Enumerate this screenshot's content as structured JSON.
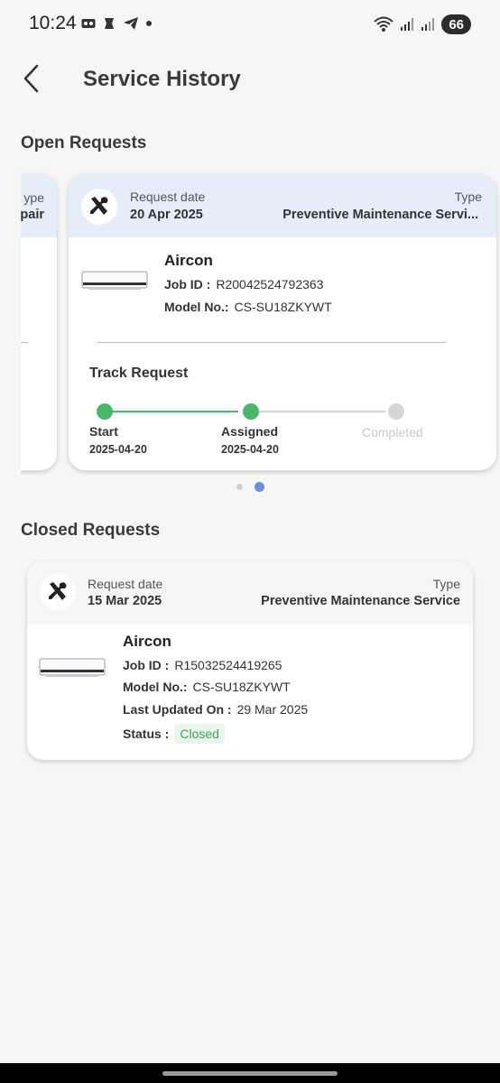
{
  "status_bar": {
    "time": "10:24",
    "battery": "66",
    "icons_left": [
      "voicemail-icon",
      "app-icon",
      "telegram-icon",
      "dot-icon"
    ],
    "icons_right": [
      "wifi-icon",
      "signal-icon",
      "signal-icon",
      "battery-icon"
    ]
  },
  "header": {
    "title": "Service History",
    "back_icon": "chevron-left-icon"
  },
  "open_requests": {
    "section_title": "Open Requests",
    "peek_card": {
      "type_label_fragment": "ype",
      "type_value_fragment": "pair"
    },
    "card": {
      "request_date_label": "Request date",
      "request_date": "20 Apr 2025",
      "type_label": "Type",
      "type_value": "Preventive Maintenance Servi...",
      "product": "Aircon",
      "job_id_label": "Job ID :",
      "job_id": "R20042524792363",
      "model_label": "Model No.:",
      "model": "CS-SU18ZKYWT",
      "track_title": "Track Request",
      "steps": [
        {
          "label": "Start",
          "date": "2025-04-20",
          "state": "done"
        },
        {
          "label": "Assigned",
          "date": "2025-04-20",
          "state": "done"
        },
        {
          "label": "Completed",
          "date": "",
          "state": "pending"
        }
      ]
    },
    "pager": {
      "count": 2,
      "active": 1
    }
  },
  "closed_requests": {
    "section_title": "Closed Requests",
    "card": {
      "request_date_label": "Request date",
      "request_date": "15 Mar 2025",
      "type_label": "Type",
      "type_value": "Preventive Maintenance Service",
      "product": "Aircon",
      "job_id_label": "Job ID :",
      "job_id": "R15032524419265",
      "model_label": "Model No.:",
      "model": "CS-SU18ZKYWT",
      "last_updated_label": "Last Updated On :",
      "last_updated": "29 Mar 2025",
      "status_label": "Status :",
      "status": "Closed"
    }
  },
  "colors": {
    "card_header_bg": "#e5edf9",
    "step_done": "#47b86a",
    "step_pending": "#d6d6d6",
    "pager_active": "#6f8fdc",
    "status_closed_text": "#3aa35a"
  }
}
